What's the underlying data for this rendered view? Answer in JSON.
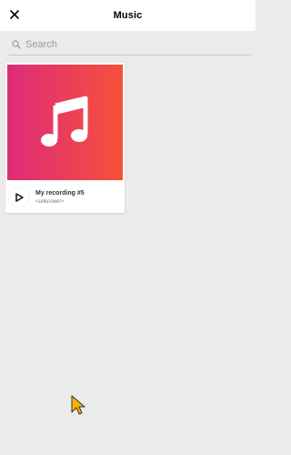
{
  "header": {
    "title": "Music",
    "close_icon": "close-icon"
  },
  "search": {
    "placeholder": "Search",
    "value": "",
    "icon": "search-icon"
  },
  "items": [
    {
      "title": "My recording #5",
      "artist": "<unknown>",
      "cover_icon": "music-note-icon",
      "play_icon": "play-icon",
      "cover_gradient": [
        "#dd2c79",
        "#f5513a"
      ]
    }
  ],
  "colors": {
    "background": "#ebebeb",
    "header_bg": "#ffffff",
    "accent_start": "#dd2c79",
    "accent_end": "#f5513a"
  }
}
